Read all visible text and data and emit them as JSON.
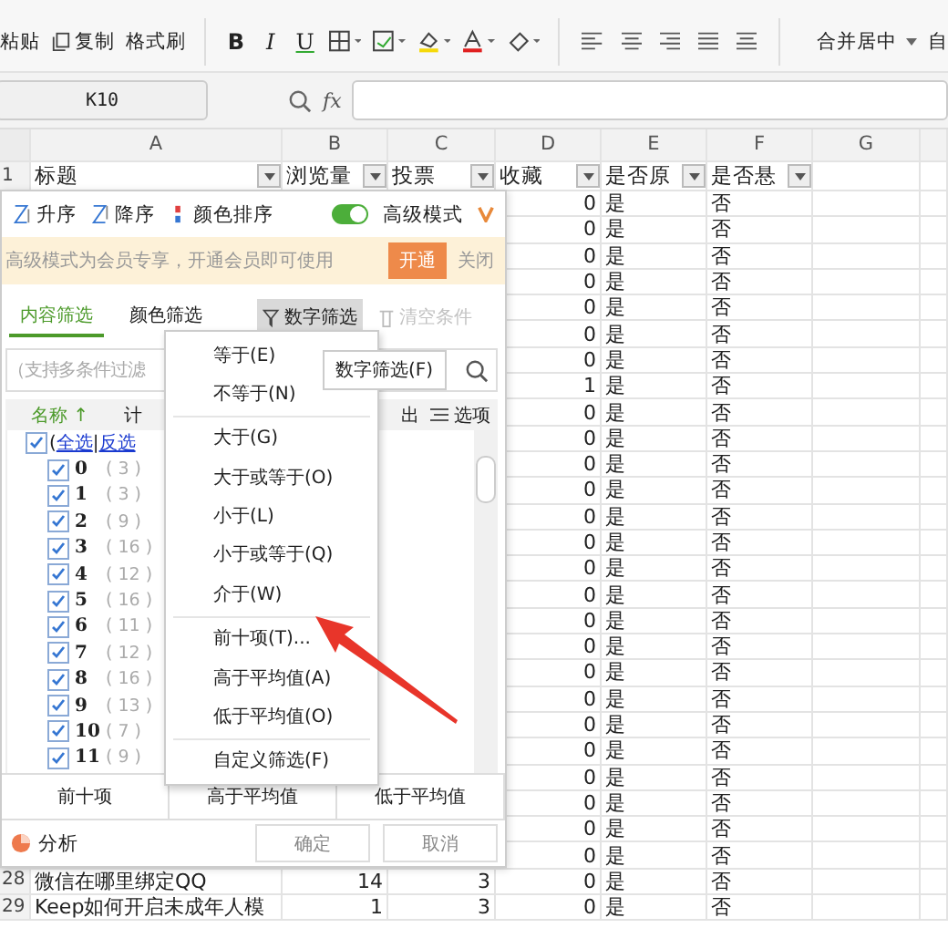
{
  "toolbar": {
    "clipboard": [
      {
        "kind": "paste",
        "label": "粘贴"
      },
      {
        "kind": "copy",
        "label": "复制"
      },
      {
        "kind": "format",
        "label": "格式刷"
      }
    ],
    "font": [
      {
        "kind": "bold",
        "label": "B"
      },
      {
        "kind": "italic",
        "label": "I"
      },
      {
        "kind": "underline",
        "label": "U"
      },
      {
        "kind": "border"
      },
      {
        "kind": "fill"
      },
      {
        "kind": "highlight"
      },
      {
        "kind": "fontcolor"
      },
      {
        "kind": "eraser"
      }
    ],
    "align": [
      {
        "kind": "left"
      },
      {
        "kind": "center"
      },
      {
        "kind": "right"
      },
      {
        "kind": "justify"
      },
      {
        "kind": "distribute"
      }
    ],
    "merge": "合并居中",
    "more": "自"
  },
  "formula_bar": {
    "name_box": "K10",
    "fx": "fx"
  },
  "columns": [
    "A",
    "B",
    "C",
    "D",
    "E",
    "F",
    "G"
  ],
  "header_row": {
    "row": "1",
    "cells": [
      "标题",
      "浏览量",
      "投票",
      "收藏",
      "是否原",
      "是否悬"
    ]
  },
  "rows": [
    {
      "favorites": "0",
      "original": "是",
      "reward": "否"
    },
    {
      "favorites": "0",
      "original": "是",
      "reward": "否"
    },
    {
      "favorites": "0",
      "original": "是",
      "reward": "否"
    },
    {
      "favorites": "0",
      "original": "是",
      "reward": "否"
    },
    {
      "favorites": "0",
      "original": "是",
      "reward": "否"
    },
    {
      "favorites": "0",
      "original": "是",
      "reward": "否"
    },
    {
      "favorites": "0",
      "original": "是",
      "reward": "否"
    },
    {
      "favorites": "1",
      "original": "是",
      "reward": "否"
    },
    {
      "favorites": "0",
      "original": "是",
      "reward": "否"
    },
    {
      "favorites": "0",
      "original": "是",
      "reward": "否"
    },
    {
      "favorites": "0",
      "original": "是",
      "reward": "否"
    },
    {
      "favorites": "0",
      "original": "是",
      "reward": "否"
    },
    {
      "favorites": "0",
      "original": "是",
      "reward": "否"
    },
    {
      "favorites": "0",
      "original": "是",
      "reward": "否"
    },
    {
      "favorites": "0",
      "original": "是",
      "reward": "否"
    },
    {
      "favorites": "0",
      "original": "是",
      "reward": "否"
    },
    {
      "favorites": "0",
      "original": "是",
      "reward": "否"
    },
    {
      "favorites": "0",
      "original": "是",
      "reward": "否"
    },
    {
      "favorites": "0",
      "original": "是",
      "reward": "否"
    },
    {
      "favorites": "0",
      "original": "是",
      "reward": "否"
    },
    {
      "favorites": "0",
      "original": "是",
      "reward": "否"
    },
    {
      "favorites": "0",
      "original": "是",
      "reward": "否"
    },
    {
      "favorites": "0",
      "original": "是",
      "reward": "否"
    },
    {
      "favorites": "0",
      "original": "是",
      "reward": "否"
    },
    {
      "favorites": "0",
      "original": "是",
      "reward": "否"
    },
    {
      "favorites": "0",
      "original": "是",
      "reward": "否"
    },
    {
      "row": "28",
      "title": "微信在哪里绑定QQ",
      "views": "14",
      "votes": "3",
      "favorites": "0",
      "original": "是",
      "reward": "否"
    },
    {
      "row": "29",
      "title": "Keep如何开启未成年人模",
      "views": "1",
      "votes": "3",
      "favorites": "0",
      "original": "是",
      "reward": "否"
    }
  ],
  "filter_panel": {
    "sort": [
      {
        "kind": "asc",
        "label": "升序"
      },
      {
        "kind": "desc",
        "label": "降序"
      },
      {
        "kind": "color",
        "label": "颜色排序"
      }
    ],
    "advanced_mode": {
      "label": "高级模式",
      "on": true
    },
    "notice": {
      "text": "高级模式为会员专享，开通会员即可使用",
      "action": "开通",
      "close": "关闭"
    },
    "tabs": [
      {
        "label": "内容筛选",
        "selected": true
      },
      {
        "label": "颜色筛选",
        "selected": false
      }
    ],
    "number_filter": {
      "label": "数字筛选",
      "active": true
    },
    "clear": {
      "label": "清空条件",
      "disabled": true
    },
    "search": {
      "placeholder": "（支持多条件过滤"
    },
    "list_header": {
      "name": "名称",
      "sort_mark": "↑",
      "column_2": "计",
      "column_3": "出",
      "options": "选项"
    },
    "select_all": {
      "open": "(",
      "all": "全选",
      "separator": "|",
      "invert": "反选",
      "checked": true
    },
    "items": [
      {
        "label": "0",
        "count": "( 3 )",
        "checked": true
      },
      {
        "label": "1",
        "count": "( 3 )",
        "checked": true
      },
      {
        "label": "2",
        "count": "( 9 )",
        "checked": true
      },
      {
        "label": "3",
        "count": "( 16 )",
        "checked": true
      },
      {
        "label": "4",
        "count": "( 12 )",
        "checked": true
      },
      {
        "label": "5",
        "count": "( 16 )",
        "checked": true
      },
      {
        "label": "6",
        "count": "( 11 )",
        "checked": true
      },
      {
        "label": "7",
        "count": "( 12 )",
        "checked": true
      },
      {
        "label": "8",
        "count": "( 16 )",
        "checked": true
      },
      {
        "label": "9",
        "count": "( 13 )",
        "checked": true
      },
      {
        "label": "10",
        "count": "( 7 )",
        "checked": true
      },
      {
        "label": "11",
        "count": "( 9 )",
        "checked": true
      }
    ],
    "quick": [
      "前十项",
      "高于平均值",
      "低于平均值"
    ],
    "analysis": "分析",
    "ok": "确定",
    "cancel": "取消"
  },
  "menu": [
    [
      "等于(E)",
      "不等于(N)"
    ],
    [
      "大于(G)",
      "大于或等于(O)",
      "小于(L)",
      "小于或等于(Q)",
      "介于(W)"
    ],
    [
      "前十项(T)...",
      "高于平均值(A)",
      "低于平均值(O)"
    ],
    [
      "自定义筛选(F)"
    ]
  ],
  "tooltip": "数字筛选(F)"
}
